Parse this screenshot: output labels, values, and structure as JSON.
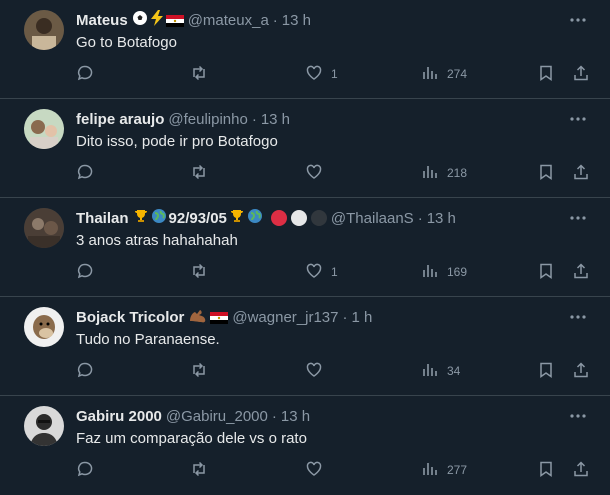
{
  "tweets": [
    {
      "display_name": "Mateus",
      "badges": [
        "soccer-ball",
        "lightning",
        "egypt-flag"
      ],
      "handle": "@mateux_a",
      "dot": "·",
      "time": "13 h",
      "text": "Go to Botafogo",
      "likes": "1",
      "views": "274"
    },
    {
      "display_name": "felipe araujo",
      "badges": [],
      "handle": "@feulipinho",
      "dot": "·",
      "time": "13 h",
      "text": "Dito isso, pode ir pro Botafogo",
      "likes": "",
      "views": "218"
    },
    {
      "display_name": "Thailan",
      "badges": [
        "trophy",
        "globe",
        "trophy",
        "globe",
        "red-circle",
        "white-circle",
        "black-circle"
      ],
      "badge_text": "92/93/05",
      "handle": "@ThailaanS",
      "dot": "·",
      "time": "13 h",
      "text": "3 anos atras hahahahah",
      "likes": "1",
      "views": "169"
    },
    {
      "display_name": "Bojack Tricolor",
      "badges": [
        "bicep",
        "egypt-flag"
      ],
      "handle": "@wagner_jr137",
      "dot": "·",
      "time": "1 h",
      "text": "Tudo no Paranaense.",
      "likes": "",
      "views": "34"
    },
    {
      "display_name": "Gabiru 2000",
      "badges": [],
      "handle": "@Gabiru_2000",
      "dot": "·",
      "time": "13 h",
      "text": "Faz um comparação dele vs o rato",
      "likes": "",
      "views": "277"
    }
  ],
  "colors": {
    "background": "#15202b",
    "text": "#e7e9ea",
    "muted": "#8b98a5",
    "divider": "#38444d"
  }
}
